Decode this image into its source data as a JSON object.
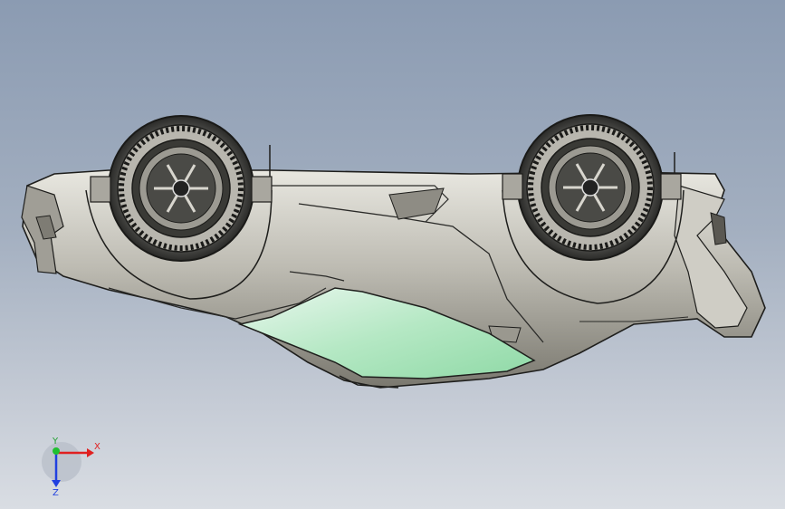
{
  "viewport": {
    "background_top": "#8b9bb2",
    "background_bottom": "#d9dde3"
  },
  "model": {
    "body_color": "#c9c8c0",
    "glass_color": "#a8e3b8",
    "wheel_color": "#2a2a2a"
  },
  "triad": {
    "x_label": "X",
    "y_label": "Y",
    "z_label": "Z",
    "x_color": "#e02020",
    "y_color": "#20c030",
    "z_color": "#2040e0"
  }
}
